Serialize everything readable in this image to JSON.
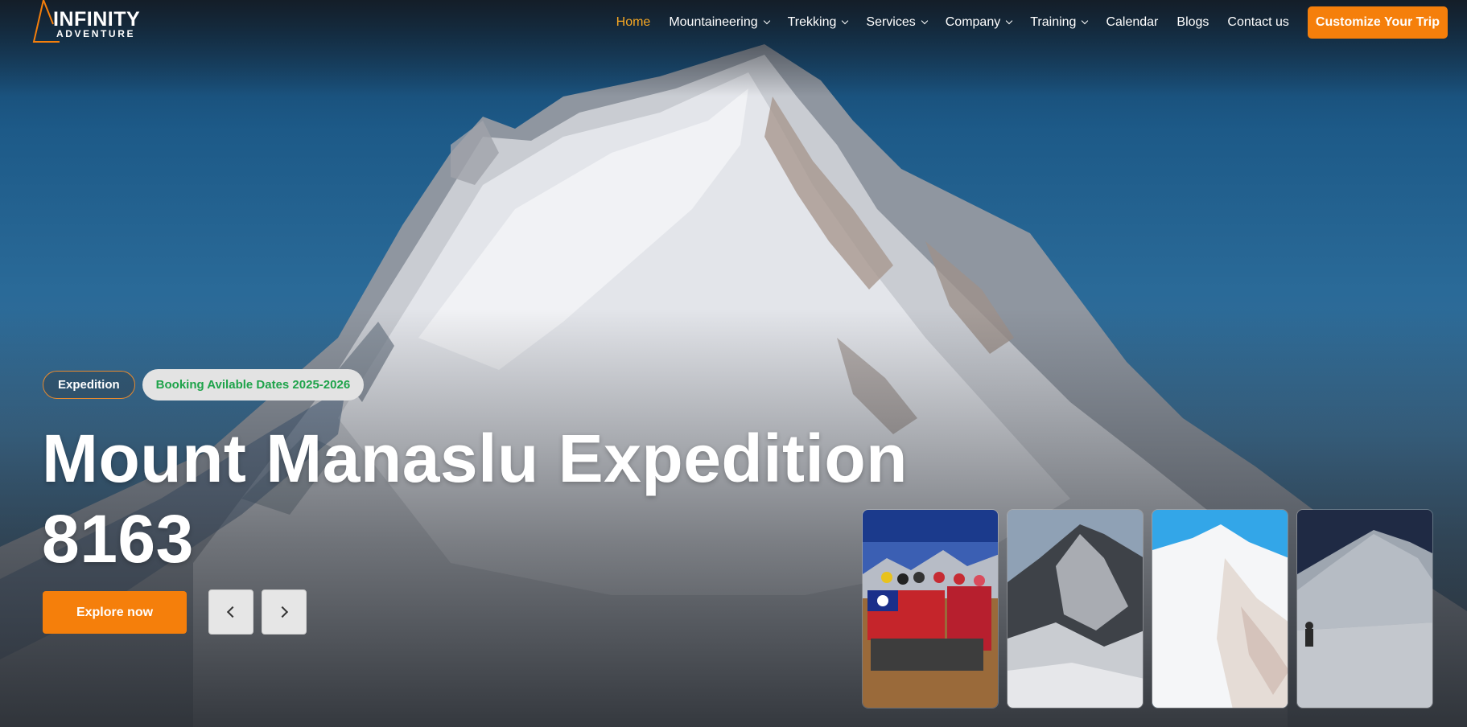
{
  "brand": {
    "name_top": "INFINITY",
    "name_bottom": "ADVENTURE",
    "accent_color": "#f57f0b",
    "active_nav_color": "#f6a723"
  },
  "nav": {
    "items": [
      {
        "label": "Home",
        "active": true,
        "has_dropdown": false
      },
      {
        "label": "Mountaineering",
        "active": false,
        "has_dropdown": true
      },
      {
        "label": "Trekking",
        "active": false,
        "has_dropdown": true
      },
      {
        "label": "Services",
        "active": false,
        "has_dropdown": true
      },
      {
        "label": "Company",
        "active": false,
        "has_dropdown": true
      },
      {
        "label": "Training",
        "active": false,
        "has_dropdown": true
      },
      {
        "label": "Calendar",
        "active": false,
        "has_dropdown": false
      },
      {
        "label": "Blogs",
        "active": false,
        "has_dropdown": false
      },
      {
        "label": "Contact us",
        "active": false,
        "has_dropdown": false
      }
    ],
    "cta_label": "Customize Your Trip"
  },
  "hero": {
    "tag_category": "Expedition",
    "tag_booking": "Booking Avilable Dates 2025-2026",
    "title_line1": "Mount Manaslu Expedition",
    "title_line2": "8163",
    "explore_label": "Explore now",
    "prev_icon": "chevron-left-icon",
    "next_icon": "chevron-right-icon"
  },
  "thumbnails": [
    {
      "name": "thumb-group-photo"
    },
    {
      "name": "thumb-rocky-peak"
    },
    {
      "name": "thumb-snowy-summit"
    },
    {
      "name": "thumb-climber-on-glacier"
    }
  ]
}
